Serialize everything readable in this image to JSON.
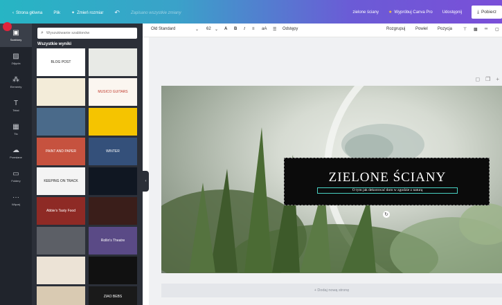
{
  "topbar": {
    "back": "Strona główna",
    "file": "Plik",
    "resize": "Zmień rozmiar",
    "undo_icon": "undo-icon",
    "hint": "Zapisano wszystkie zmiany",
    "design_name": "zielone ściany",
    "try_pro": "Wypróbuj Canva Pro",
    "share": "Udostępnij",
    "download": "Pobierz"
  },
  "rail": {
    "items": [
      {
        "label": "Szablony",
        "icon": "template-icon"
      },
      {
        "label": "Zdjęcia",
        "icon": "photo-icon"
      },
      {
        "label": "Elementy",
        "icon": "elements-icon"
      },
      {
        "label": "Tekst",
        "icon": "text-icon"
      },
      {
        "label": "Tło",
        "icon": "background-icon"
      },
      {
        "label": "Przesłane",
        "icon": "upload-icon"
      },
      {
        "label": "Foldery",
        "icon": "folder-icon"
      },
      {
        "label": "Więcej",
        "icon": "more-icon"
      }
    ]
  },
  "panel": {
    "search_placeholder": "Wyszukiwanie szablonów",
    "results_label": "Wszystkie wyniki",
    "tiles": [
      {
        "text": "BLOG POST",
        "bg": "#ffffff",
        "fg": "#222222"
      },
      {
        "text": "",
        "bg": "#e8eae6",
        "fg": "#333333"
      },
      {
        "text": "",
        "bg": "#f3ecd9",
        "fg": "#333333"
      },
      {
        "text": "MUSICO GUITARS",
        "bg": "#fbf6f0",
        "fg": "#c0392b"
      },
      {
        "text": "",
        "bg": "#4a6a8a",
        "fg": "#ffffff"
      },
      {
        "text": "",
        "bg": "#f5c400",
        "fg": "#222222"
      },
      {
        "text": "PAINT AND PAPER",
        "bg": "#c6523f",
        "fg": "#ffffff"
      },
      {
        "text": "WINTER",
        "bg": "#34507a",
        "fg": "#ffffff"
      },
      {
        "text": "KEEPING ON TRACK",
        "bg": "#f4f4f4",
        "fg": "#222222"
      },
      {
        "text": "",
        "bg": "#101722",
        "fg": "#ffffff"
      },
      {
        "text": "Abbie's Tasty Food",
        "bg": "#8e2a25",
        "fg": "#ffffff"
      },
      {
        "text": "",
        "bg": "#3a1e1a",
        "fg": "#ffffff"
      },
      {
        "text": "",
        "bg": "#5c5f66",
        "fg": "#ffffff"
      },
      {
        "text": "Rollin's Theatre",
        "bg": "#5a4a86",
        "fg": "#ffffff"
      },
      {
        "text": "",
        "bg": "#ece3d6",
        "fg": "#333333"
      },
      {
        "text": "",
        "bg": "#111111",
        "fg": "#ffffff"
      },
      {
        "text": "",
        "bg": "#d9cab2",
        "fg": "#333333"
      },
      {
        "text": "ZIAO BEBS",
        "bg": "#1a1a1a",
        "fg": "#ffffff"
      }
    ]
  },
  "toolbar": {
    "font": "Old Standard",
    "size": "62",
    "text_color": "A",
    "bold": "B",
    "italic": "I",
    "spacing_icon": "≡",
    "case": "aA",
    "list_icon": "☰",
    "spacing_label": "Odstępy",
    "group": "Rozgrupuj",
    "duplicate": "Powiel",
    "position": "Pozycja"
  },
  "design": {
    "title": "ZIELONE ŚCIANY",
    "subtitle": "O tym jak dekorować dom w zgodzie z naturą"
  },
  "add_page": "+ Dodaj nową stronę",
  "colors": {
    "accent": "#48d2c4",
    "rail_bg": "#20242c",
    "panel_bg": "#2b2f38"
  }
}
